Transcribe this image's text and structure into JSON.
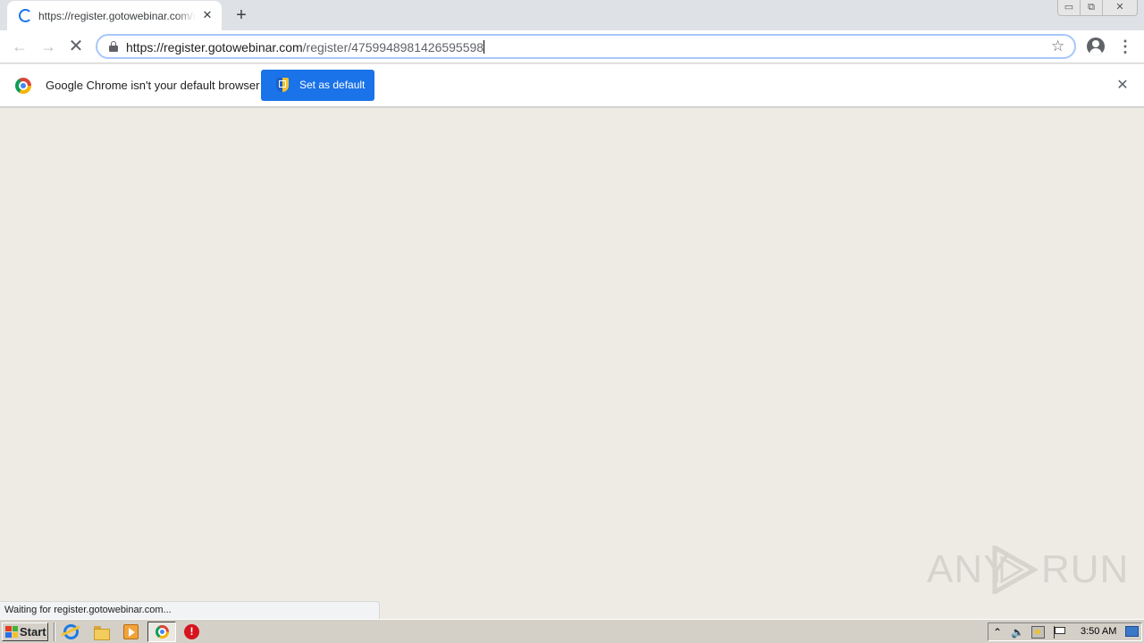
{
  "browser": {
    "tab": {
      "title": "https://register.gotowebinar.com/register/4759948981426595598",
      "close_glyph": "✕",
      "loading": true
    },
    "new_tab_glyph": "+",
    "window_controls": {
      "minimize": "▭",
      "maximize": "⧉",
      "close": "✕"
    },
    "toolbar": {
      "back_glyph": "←",
      "forward_glyph": "→",
      "stop_glyph": "✕",
      "url_host": "https://register.gotowebinar.com",
      "url_path": "/register/4759948981426595598",
      "bookmark_glyph": "☆",
      "menu_glyph": "⋮"
    },
    "infobar": {
      "message": "Google Chrome isn't your default browser",
      "button_label": "Set as default",
      "close_glyph": "✕",
      "button_color": "#1a73e8"
    },
    "status_text": "Waiting for register.gotowebinar.com..."
  },
  "watermark": {
    "left": "ANY",
    "right": "RUN"
  },
  "taskbar": {
    "start_label": "Start",
    "stop_app_glyph": "!",
    "tray_chevron": "⌃",
    "speaker_glyph": "🔈",
    "clock": "3:50 AM"
  },
  "colors": {
    "content_background": "#eeebe5",
    "accent": "#1a73e8",
    "taskbar": "#d4d0c8"
  }
}
